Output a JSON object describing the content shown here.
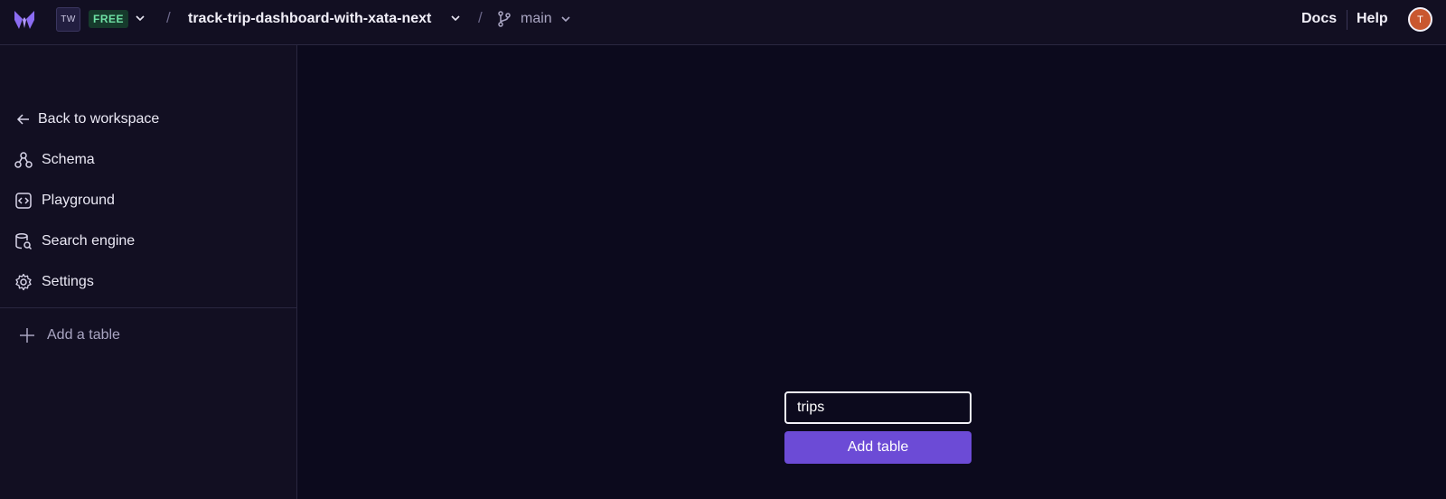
{
  "header": {
    "workspace_initials": "TW",
    "plan": "FREE",
    "separator": "/",
    "database": "track-trip-dashboard-with-xata-next",
    "branch": "main",
    "docs_label": "Docs",
    "help_label": "Help",
    "avatar_initial": "T"
  },
  "sidebar": {
    "back_label": "Back to workspace",
    "items": [
      {
        "label": "Schema",
        "icon": "schema-icon"
      },
      {
        "label": "Playground",
        "icon": "code-icon"
      },
      {
        "label": "Search engine",
        "icon": "database-search-icon"
      },
      {
        "label": "Settings",
        "icon": "gear-icon"
      }
    ],
    "add_table_label": "Add a table"
  },
  "main": {
    "table_name_value": "trips",
    "add_table_button": "Add table"
  },
  "colors": {
    "background": "#0c0a1d",
    "panel": "#120f22",
    "accent": "#6c4bd6",
    "plan_badge_text": "#6fe0a5",
    "avatar": "#c9572f"
  }
}
